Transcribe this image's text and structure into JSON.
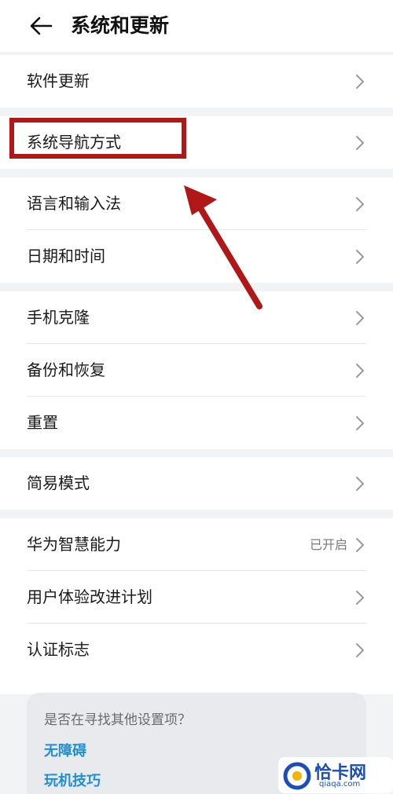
{
  "header": {
    "title": "系统和更新"
  },
  "groups": [
    {
      "items": [
        {
          "label": "软件更新",
          "value": ""
        }
      ]
    },
    {
      "items": [
        {
          "label": "系统导航方式",
          "value": ""
        }
      ]
    },
    {
      "items": [
        {
          "label": "语言和输入法",
          "value": ""
        },
        {
          "label": "日期和时间",
          "value": ""
        }
      ]
    },
    {
      "items": [
        {
          "label": "手机克隆",
          "value": ""
        },
        {
          "label": "备份和恢复",
          "value": ""
        },
        {
          "label": "重置",
          "value": ""
        }
      ]
    },
    {
      "items": [
        {
          "label": "简易模式",
          "value": ""
        }
      ]
    },
    {
      "items": [
        {
          "label": "华为智慧能力",
          "value": "已开启"
        },
        {
          "label": "用户体验改进计划",
          "value": ""
        },
        {
          "label": "认证标志",
          "value": ""
        }
      ]
    }
  ],
  "suggestions": {
    "title": "是否在寻找其他设置项？",
    "links": [
      "无障碍",
      "玩机技巧"
    ]
  },
  "watermark": {
    "name": "恰卡网",
    "domain": "qiaqa.com"
  },
  "colors": {
    "highlight": "#b01818",
    "link": "#1e8fd6",
    "background": "#f1f3f5"
  }
}
